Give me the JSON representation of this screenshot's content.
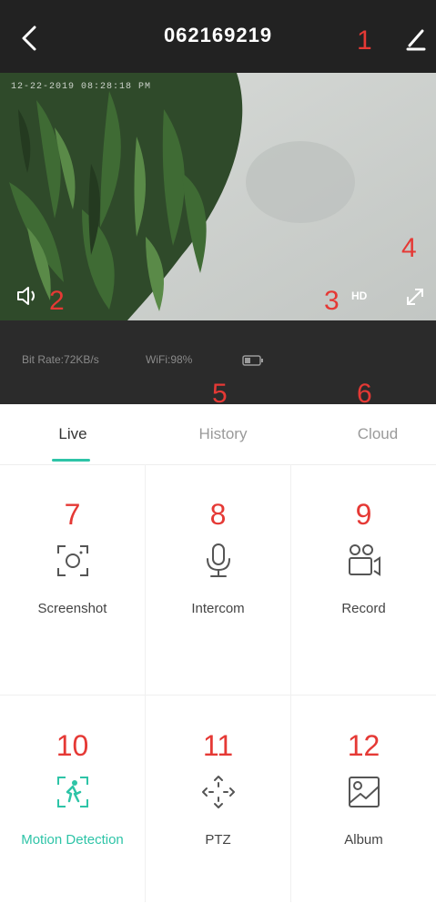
{
  "header": {
    "title": "062169219",
    "annotation_edit": "1"
  },
  "video": {
    "timestamp": "12-22-2019 08:28:18 PM",
    "annotation_volume": "2",
    "annotation_quality": "3",
    "annotation_fullscreen": "4",
    "quality_label": "HD"
  },
  "status": {
    "bitrate": "Bit Rate:72KB/s",
    "wifi": "WiFi:98%"
  },
  "tabs": {
    "annotation_history": "5",
    "annotation_cloud": "6",
    "items": [
      {
        "label": "Live"
      },
      {
        "label": "History"
      },
      {
        "label": "Cloud"
      }
    ]
  },
  "actions": [
    {
      "num": "7",
      "label": "Screenshot",
      "icon": "screenshot-icon"
    },
    {
      "num": "8",
      "label": "Intercom",
      "icon": "microphone-icon"
    },
    {
      "num": "9",
      "label": "Record",
      "icon": "record-icon"
    },
    {
      "num": "10",
      "label": "Motion Detection",
      "icon": "motion-detection-icon"
    },
    {
      "num": "11",
      "label": "PTZ",
      "icon": "ptz-icon"
    },
    {
      "num": "12",
      "label": "Album",
      "icon": "album-icon"
    }
  ],
  "colors": {
    "accent": "#2ec4a7",
    "annotation": "#e53935",
    "header_bg": "#222222",
    "status_bg": "#2b2b2b"
  }
}
